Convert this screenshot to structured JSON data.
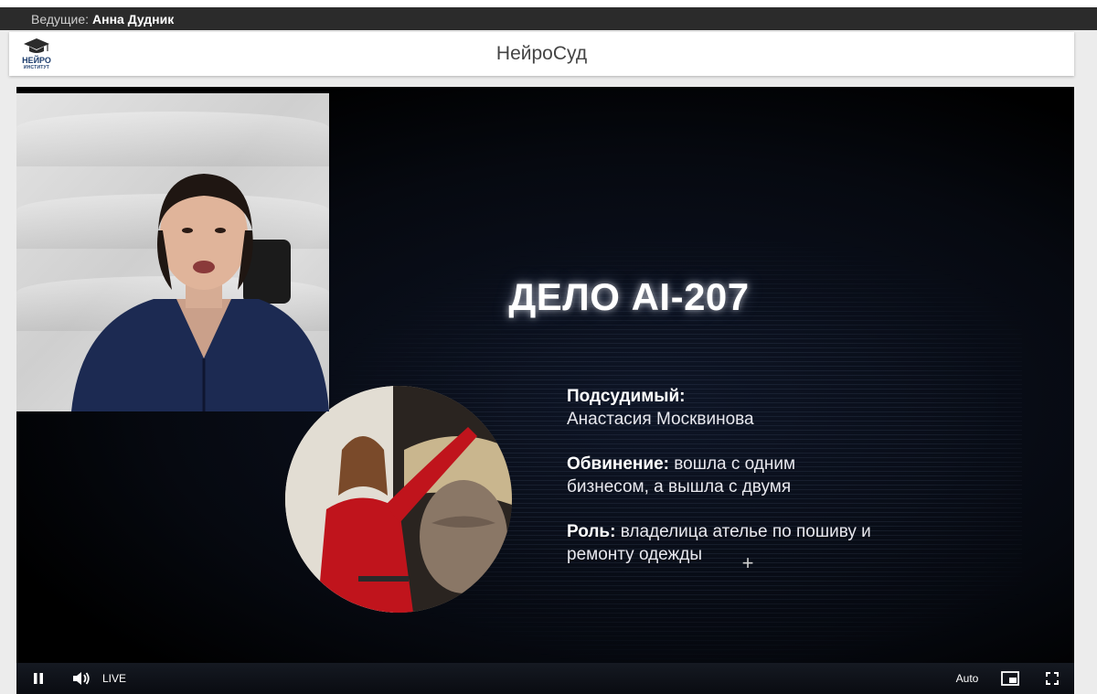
{
  "host_bar": {
    "label": "Ведущие:",
    "host_name": "Анна Дудник"
  },
  "header": {
    "title": "НейроСуд",
    "logo": {
      "icon": "graduation-cap-icon",
      "main": "НЕЙРО",
      "sub": "ИНСТИТУТ",
      "color": "#1e3e6e"
    }
  },
  "slide": {
    "case_title": "ДЕЛО AI-207",
    "defendant_label": "Подсудимый:",
    "defendant_name": "Анастасия Москвинова",
    "charge_label": "Обвинение:",
    "charge_text_1": "вошла с одним",
    "charge_text_2": "бизнесом, а вышла с двумя",
    "role_label": "Роль:",
    "role_text_1": "владелица ателье по пошиву и",
    "role_text_2": "ремонту одежды",
    "crosshair": "+"
  },
  "controls": {
    "pause_icon": "pause-icon",
    "volume_icon": "volume-icon",
    "live_label": "LIVE",
    "quality_label": "Auto",
    "pip_icon": "picture-in-picture-icon",
    "fullscreen_icon": "fullscreen-icon"
  },
  "colors": {
    "host_bar_bg": "#2b2b2b",
    "player_bg": "#000000",
    "slide_text": "#e8e8ee",
    "presenter_top": "#1c2a52"
  }
}
